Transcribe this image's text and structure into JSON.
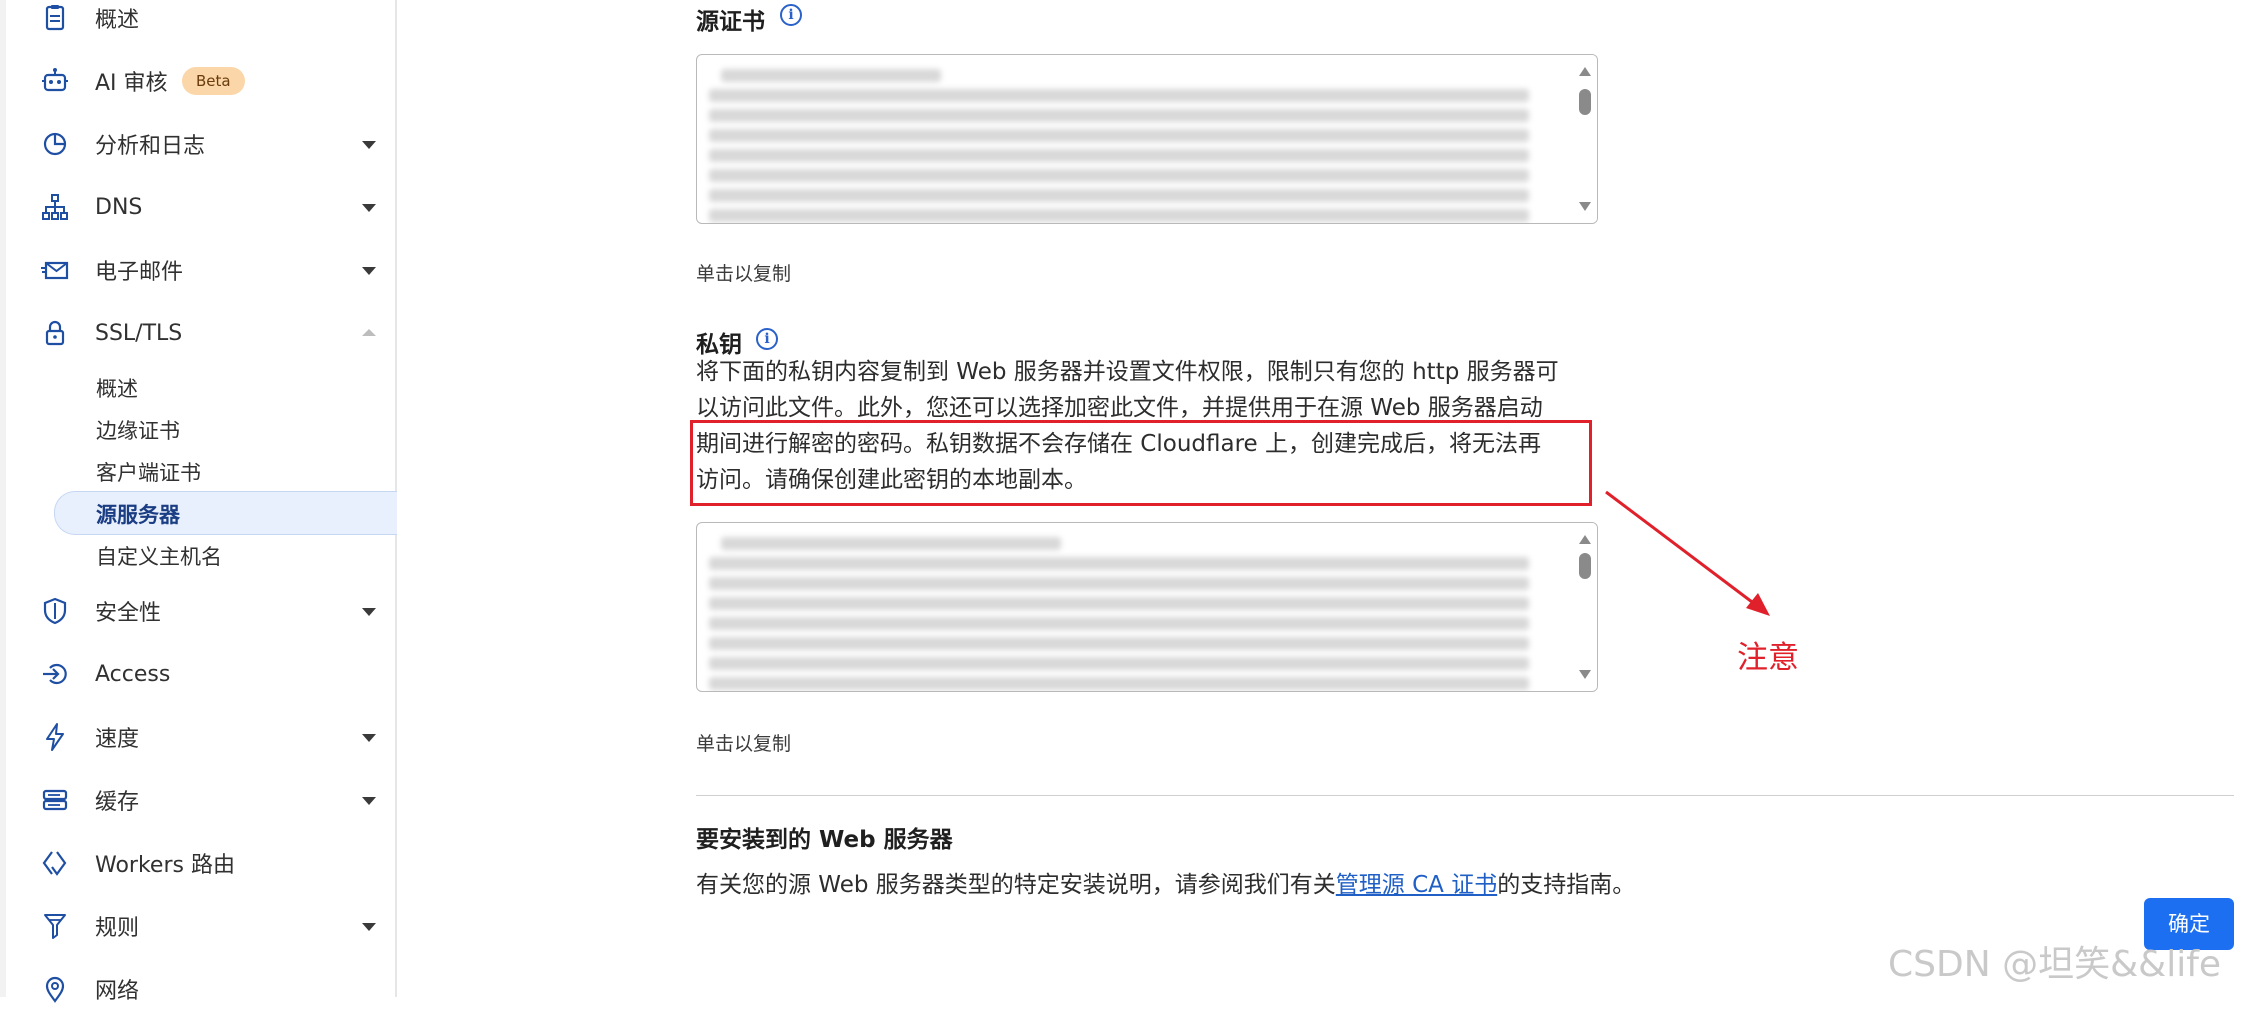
{
  "sidebar": {
    "items": [
      {
        "label": "概述",
        "icon": "document-icon"
      },
      {
        "label": "AI 审核",
        "icon": "robot-icon",
        "badge": "Beta"
      },
      {
        "label": "分析和日志",
        "icon": "pie-chart-icon"
      },
      {
        "label": "DNS",
        "icon": "sitemap-icon"
      },
      {
        "label": "电子邮件",
        "icon": "email-icon"
      },
      {
        "label": "SSL/TLS",
        "icon": "lock-icon"
      },
      {
        "label": "安全性",
        "icon": "shield-icon"
      },
      {
        "label": "Access",
        "icon": "access-icon"
      },
      {
        "label": "速度",
        "icon": "lightning-icon"
      },
      {
        "label": "缓存",
        "icon": "storage-icon"
      },
      {
        "label": "Workers 路由",
        "icon": "workers-icon"
      },
      {
        "label": "规则",
        "icon": "funnel-icon"
      },
      {
        "label": "网络",
        "icon": "location-pin-icon"
      }
    ],
    "ssl_sub_items": [
      "概述",
      "边缘证书",
      "客户端证书",
      "源服务器",
      "自定义主机名"
    ],
    "active_sub_item": "源服务器"
  },
  "main": {
    "origin_cert": {
      "title": "源证书",
      "copy_hint": "单击以复制"
    },
    "private_key": {
      "title": "私钥",
      "description_lines": [
        "将下面的私钥内容复制到 Web 服务器并设置文件权限，限制只有您的 http 服务器可",
        "以访问此文件。此外，您还可以选择加密此文件，并提供用于在源 Web 服务器启动",
        "期间进行解密的密码。私钥数据不会存储在 Cloudflare 上，创建完成后，将无法再",
        "访问。请确保创建此密钥的本地副本。"
      ],
      "copy_hint": "单击以复制"
    },
    "install": {
      "title": "要安装到的 Web 服务器",
      "text_before": "有关您的源 Web 服务器类型的特定安装说明，请参阅我们有关",
      "link": "管理源 CA 证书",
      "text_after": "的支持指南。"
    },
    "confirm_button": "确定"
  },
  "annotation": {
    "label": "注意",
    "color": "#e0212b"
  },
  "watermark": "CSDN @坦笑&&life",
  "colors": {
    "accent_blue": "#1d6ff2",
    "icon_blue": "#1f4fa3",
    "active_bg": "#e8f0fd"
  }
}
